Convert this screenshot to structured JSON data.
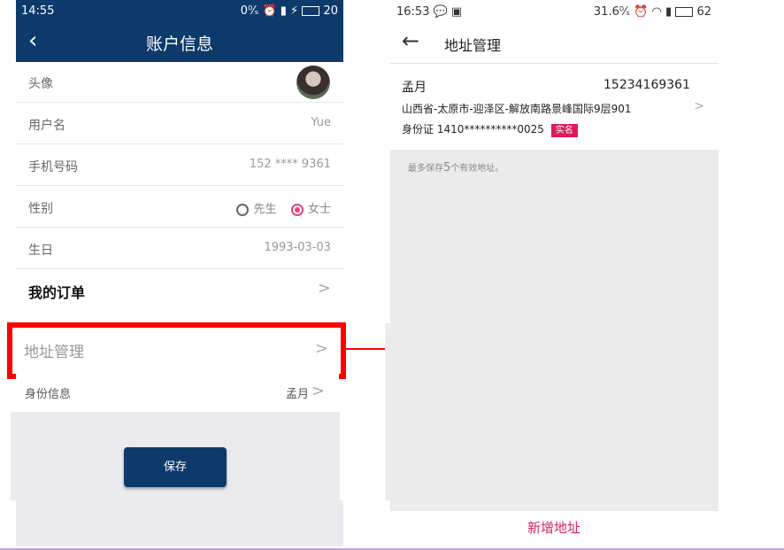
{
  "left_phone": {
    "status": {
      "time": "14:55",
      "net": "0⁰⁄ₛ",
      "battery": "20"
    },
    "header": {
      "title": "账户信息"
    },
    "rows": {
      "avatar_label": "头像",
      "username_label": "用户名",
      "username_value": "Yue",
      "phone_label": "手机号码",
      "phone_value": "152 **** 9361",
      "gender_label": "性别",
      "gender_male": "先生",
      "gender_female": "女士",
      "gender_selected": "女士",
      "birthday_label": "生日",
      "birthday_value": "1993-03-03",
      "orders_label": "我的订单",
      "address_label": "地址管理",
      "identity_label": "身份信息",
      "identity_value": "孟月"
    },
    "save_label": "保存"
  },
  "right_phone": {
    "status": {
      "time": "16:53",
      "net": "31.6⁰⁄ₛ",
      "battery": "62"
    },
    "header": {
      "title": "地址管理"
    },
    "address": {
      "name": "孟月",
      "phone": "15234169361",
      "full_address": "山西省-太原市-迎泽区-解放南路景峰国际9层901",
      "id_line": "身份证 1410**********0025",
      "verified_badge": "实名"
    },
    "tip_prefix": "最多保存",
    "tip_count": "5",
    "tip_suffix": "个有效地址。",
    "add_label": "新增地址"
  },
  "colors": {
    "navy": "#0d3a6b",
    "pink": "#e8437a",
    "highlight": "#ff0000",
    "badge": "#e0195e"
  }
}
